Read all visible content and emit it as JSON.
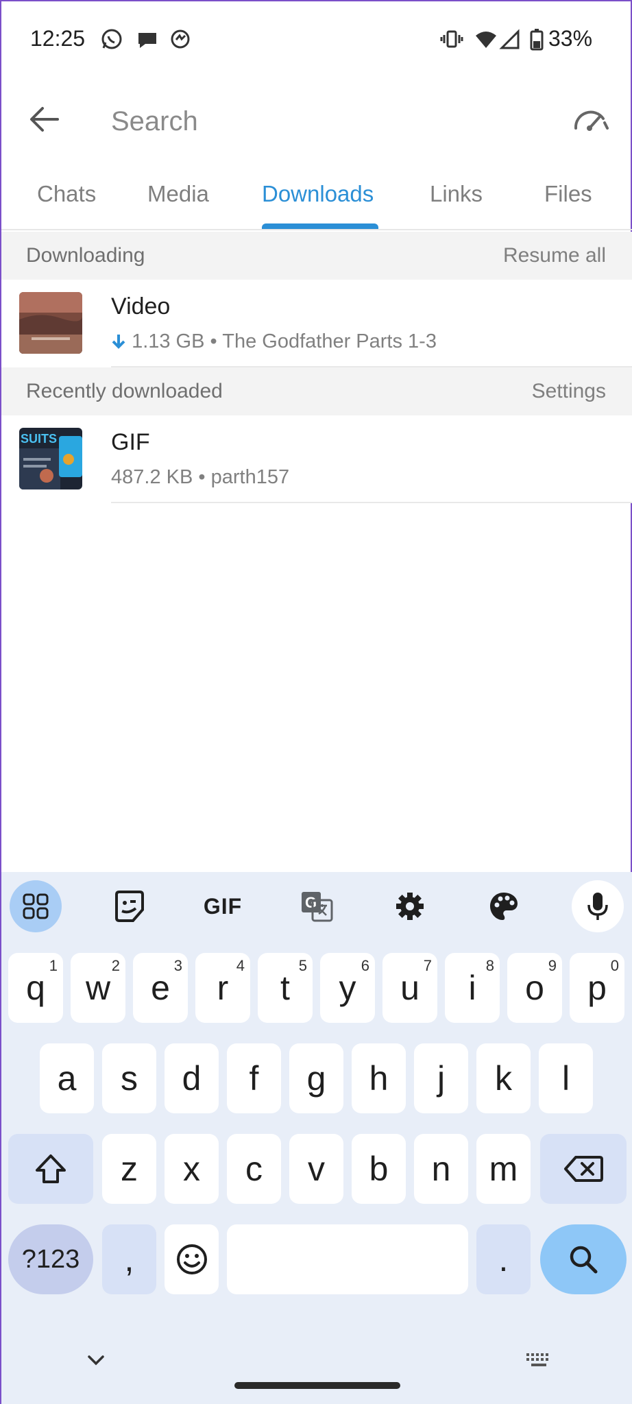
{
  "status_bar": {
    "time": "12:25",
    "battery": "33%"
  },
  "header": {
    "search_placeholder": "Search"
  },
  "tabs": [
    {
      "label": "Chats",
      "active": false
    },
    {
      "label": "Media",
      "active": false
    },
    {
      "label": "Downloads",
      "active": true
    },
    {
      "label": "Links",
      "active": false
    },
    {
      "label": "Files",
      "active": false
    }
  ],
  "downloading": {
    "title": "Downloading",
    "action": "Resume all",
    "items": [
      {
        "name": "Video",
        "size": "1.13 GB",
        "source": "The Godfather Parts 1-3"
      }
    ]
  },
  "recent": {
    "title": "Recently downloaded",
    "action": "Settings",
    "items": [
      {
        "name": "GIF",
        "size": "487.2 KB",
        "source": "parth157",
        "thumb_text": "SUITS"
      }
    ]
  },
  "keyboard": {
    "toolbar_gif": "GIF",
    "row1": [
      {
        "k": "q",
        "h": "1"
      },
      {
        "k": "w",
        "h": "2"
      },
      {
        "k": "e",
        "h": "3"
      },
      {
        "k": "r",
        "h": "4"
      },
      {
        "k": "t",
        "h": "5"
      },
      {
        "k": "y",
        "h": "6"
      },
      {
        "k": "u",
        "h": "7"
      },
      {
        "k": "i",
        "h": "8"
      },
      {
        "k": "o",
        "h": "9"
      },
      {
        "k": "p",
        "h": "0"
      }
    ],
    "row2": [
      "a",
      "s",
      "d",
      "f",
      "g",
      "h",
      "j",
      "k",
      "l"
    ],
    "row3": [
      "z",
      "x",
      "c",
      "v",
      "b",
      "n",
      "m"
    ],
    "symbols_key": "?123",
    "comma_key": ",",
    "period_key": "."
  },
  "colors": {
    "accent": "#2b8fd6",
    "keyboard_bg": "#e8eef8",
    "search_key": "#8ec7f7"
  }
}
